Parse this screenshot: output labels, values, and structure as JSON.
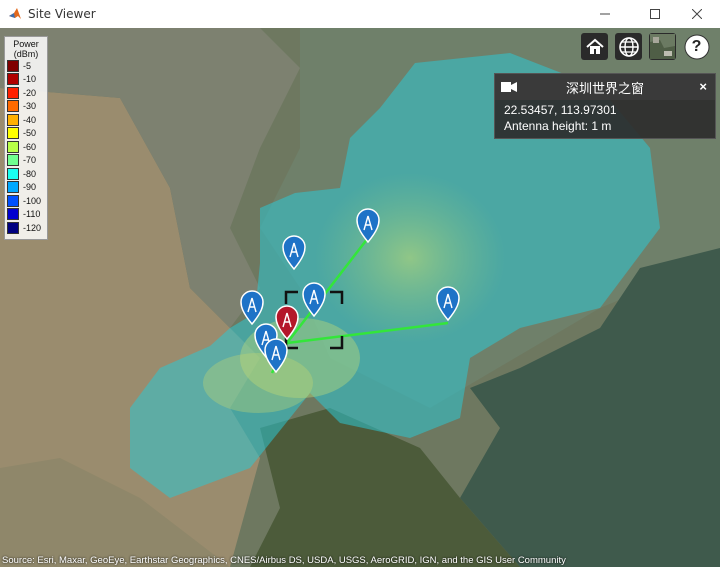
{
  "window": {
    "title": "Site Viewer",
    "minimize_icon": "minimize-icon",
    "maximize_icon": "maximize-icon",
    "close_icon": "close-icon"
  },
  "legend": {
    "title_line1": "Power",
    "title_line2": "(dBm)",
    "entries": [
      {
        "label": "-5",
        "color": "#7f0000"
      },
      {
        "label": "-10",
        "color": "#b00000"
      },
      {
        "label": "-20",
        "color": "#ff2000"
      },
      {
        "label": "-30",
        "color": "#ff6a00"
      },
      {
        "label": "-40",
        "color": "#ffb000"
      },
      {
        "label": "-50",
        "color": "#ffff00"
      },
      {
        "label": "-60",
        "color": "#b8ff48"
      },
      {
        "label": "-70",
        "color": "#70ff90"
      },
      {
        "label": "-80",
        "color": "#18fff0"
      },
      {
        "label": "-90",
        "color": "#00a8ff"
      },
      {
        "label": "-100",
        "color": "#0050ff"
      },
      {
        "label": "-110",
        "color": "#0000d0"
      },
      {
        "label": "-120",
        "color": "#000080"
      }
    ]
  },
  "toolbar": {
    "home_icon": "home-icon",
    "basemap_icon": "globe-icon",
    "imagery_icon": "basemap-thumbnail-icon",
    "help_icon": "help-icon",
    "help_label": "?"
  },
  "infobox": {
    "title": "深圳世界之窗",
    "coords": "22.53457, 113.97301",
    "antenna": "Antenna height: 1 m",
    "close_label": "×",
    "camera_icon": "camera-icon"
  },
  "attribution": "Source: Esri, Maxar, GeoEye, Earthstar Geographics, CNES/Airbus DS, USDA, USGS, AeroGRID, IGN, and the GIS User Community"
}
